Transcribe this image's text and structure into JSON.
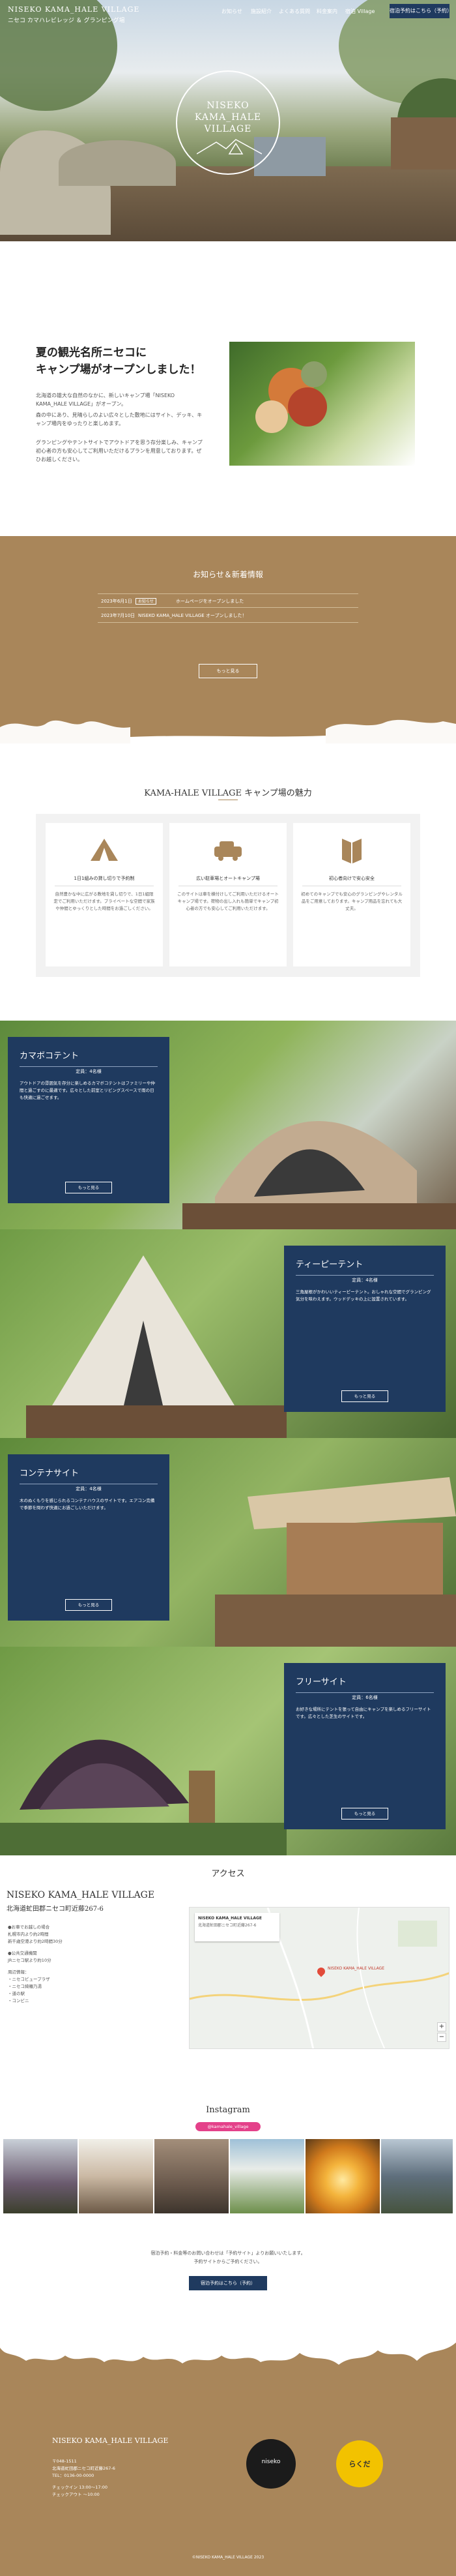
{
  "header": {
    "brand": "NISEKO KAMA_HALE VILLAGE",
    "brand_sub": "ニセコ カマハレビレッジ ＆ グランピング場",
    "nav": [
      "お知らせ",
      "施設紹介",
      "よくある質問",
      "料金案内",
      "宿泊 Village"
    ],
    "reserve": "宿泊予約はこちら（予約）"
  },
  "hero": {
    "logo_lines": [
      "NISEKO",
      "KAMA_HALE",
      "VILLAGE"
    ]
  },
  "intro": {
    "title_lines": [
      "夏の観光名所ニセコに",
      "キャンプ場がオープンしました！"
    ],
    "paragraphs": [
      "北海道の雄大な自然のなかに、新しいキャンプ場「NISEKO KAMA_HALE VILLAGE」がオープン。",
      "森の中にあり、見晴らしのよい広々とした敷地にはサイト、デッキ、キャンプ場内をゆったりと楽しめます。",
      "グランピングやテントサイトでアウトドアを思う存分楽しみ、キャンプ初心者の方も安心してご利用いただけるプランを用意しております。ぜひお越しください。"
    ]
  },
  "news": {
    "title": "お知らせ＆新着情報",
    "items": [
      {
        "date": "2023年6月1日",
        "tag": "お知らせ",
        "title": "ホームページをオープンしました"
      },
      {
        "date": "2023年7月10日",
        "tag": "NISEKO KAMA_HALE VILLAGE",
        "title": "オープンしました！"
      }
    ],
    "more": "もっと見る"
  },
  "features": {
    "title": "KAMA-HALE VILLAGE キャンプ場の魅力",
    "cards": [
      {
        "icon": "tent-icon",
        "caption": "1日1組みの貸し切りで予約制",
        "desc": "自然豊かな中に広がる敷地を貸し切りで、1日1組限定でご利用いただけます。プライベートな空間で家族や仲間とゆっくりとした時間をお過ごしください。"
      },
      {
        "icon": "car-icon",
        "caption": "広い駐車場とオートキャンプ場",
        "desc": "このサイトは車を横付けしてご利用いただけるオートキャンプ場です。荷物の出し入れも簡単でキャンプ初心者の方でも安心してご利用いただけます。"
      },
      {
        "icon": "beginner-icon",
        "caption": "初心者向けで安心安全",
        "desc": "初めてのキャンプでも安心のグランピングやレンタル品をご用意しております。キャンプ用品を忘れても大丈夫。"
      }
    ]
  },
  "sites": [
    {
      "title": "カマボコテント",
      "sub": "定員：4名様",
      "desc": "アウトドアの雰囲気を存分に楽しめるカマボコテントはファミリーや仲間と過ごすのに最適です。広々とした前室とリビングスペースで雨の日も快適に過ごせます。",
      "more": "もっと見る"
    },
    {
      "title": "ティーピーテント",
      "sub": "定員：4名様",
      "desc": "三角屋根がかわいいティーピーテント。おしゃれな空間でグランピング気分を味わえます。ウッドデッキの上に設置されています。",
      "more": "もっと見る"
    },
    {
      "title": "コンテナサイト",
      "sub": "定員：4名様",
      "desc": "木のぬくもりを感じられるコンテナハウスのサイトです。エアコン完備で季節を問わず快適にお過ごしいただけます。",
      "more": "もっと見る"
    },
    {
      "title": "フリーサイト",
      "sub": "定員：6名様",
      "desc": "お好きな場所にテントを張って自由にキャンプを楽しめるフリーサイトです。広々とした芝生のサイトです。",
      "more": "もっと見る"
    }
  ],
  "access": {
    "title": "アクセス",
    "name": "NISEKO KAMA_HALE VILLAGE",
    "address": "北海道虻田郡ニセコ町近藤267-6",
    "lines": [
      "●お車でお越しの場合",
      "札幌市内より約2時間",
      "新千歳空港より約2時間30分",
      "●公共交通機関",
      "JRニセコ駅より約10分",
      "周辺情報：",
      "・ニセコビュープラザ",
      "・ニセコ綺羅乃湯",
      "・道の駅",
      "・コンビニ"
    ],
    "map_card_title": "NISEKO KAMA_HALE VILLAGE",
    "map_card_addr": "北海道虻田郡ニセコ町近藤267-6",
    "map_pin_label": "NISEKO KAMA_HALE VILLAGE"
  },
  "instagram": {
    "title": "Instagram",
    "handle": "@kamahale_village"
  },
  "cta": {
    "lines": [
      "宿泊予約・料金等のお問い合わせは「予約サイト」よりお願いいたします。",
      "予約サイトからご予約ください。"
    ],
    "button": "宿泊予約はこちら（予約）"
  },
  "footer": {
    "name": "NISEKO KAMA_HALE VILLAGE",
    "lines": [
      "〒048-1511",
      "北海道虻田郡ニセコ町近藤267-6",
      "TEL：0136-00-0000",
      "チェックイン 13:00〜17:00",
      "チェックアウト 〜10:00"
    ],
    "logo1": "niseko",
    "logo2": "らくだ",
    "copyright": "©NISEKO KAMA_HALE VILLAGE 2023"
  },
  "colors": {
    "navy": "#1f3a5f",
    "brown": "#a9865a",
    "pink": "#e4418a"
  }
}
